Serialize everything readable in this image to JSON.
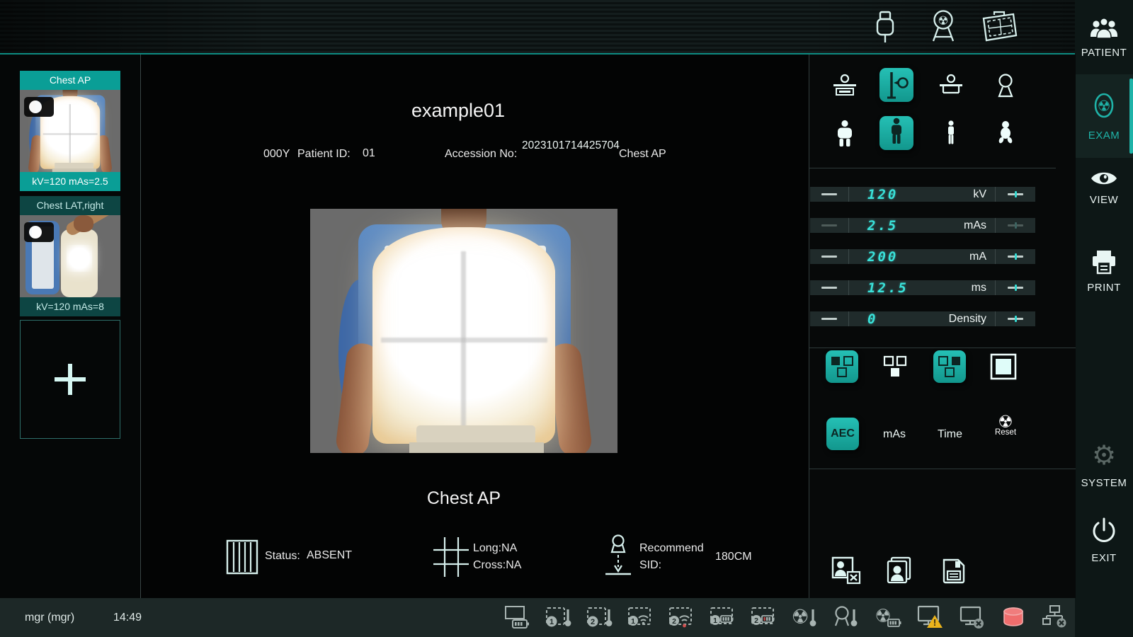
{
  "topbar": {
    "icons": [
      "usb-status",
      "tube-status",
      "detector-status"
    ]
  },
  "sidebar": {
    "items": [
      {
        "label": "PATIENT",
        "icon": "patients-icon",
        "active": false
      },
      {
        "label": "EXAM",
        "icon": "radiation-oval-icon",
        "active": true
      },
      {
        "label": "VIEW",
        "icon": "eye-icon",
        "active": false
      },
      {
        "label": "PRINT",
        "icon": "printer-icon",
        "active": false
      },
      {
        "label": "SYSTEM",
        "icon": "gear-icon",
        "active": false
      },
      {
        "label": "EXIT",
        "icon": "power-icon",
        "active": false
      }
    ]
  },
  "thumbnails": [
    {
      "title": "Chest AP",
      "tech": "kV=120 mAs=2.5",
      "selected": true
    },
    {
      "title": "Chest LAT,right",
      "tech": "kV=120 mAs=8",
      "selected": false
    }
  ],
  "study": {
    "patient_name": "example01",
    "age": "000Y",
    "patient_id_label": "Patient ID:",
    "patient_id": "01",
    "accession_label": "Accession No:",
    "accession_no": "2023101714425704",
    "view_name": "Chest AP"
  },
  "view_info": {
    "title": "Chest AP",
    "status_label": "Status:",
    "status_value": "ABSENT",
    "long_value": "Long:NA",
    "cross_value": "Cross:NA",
    "recommend_label": "Recommend",
    "sid_label": "SID:",
    "sid_value": "180CM"
  },
  "generator": {
    "rows": [
      {
        "value": "120",
        "unit": "kV"
      },
      {
        "value": "2.5",
        "unit": "mAs"
      },
      {
        "value": "200",
        "unit": "mA"
      },
      {
        "value": "12.5",
        "unit": "ms"
      },
      {
        "value": "0",
        "unit": "Density"
      }
    ]
  },
  "positions": {
    "receptors": [
      "table-bucky",
      "wall-stand",
      "table-top",
      "free-exposure"
    ],
    "selected_receptor": "wall-stand",
    "body_types": [
      "large-adult",
      "adult",
      "slim-adult",
      "child"
    ],
    "selected_body_type": "adult"
  },
  "aec": {
    "chambers": [
      "left-chamber",
      "center-chamber",
      "right-chamber",
      "full-field"
    ],
    "modes": {
      "aec": "AEC",
      "mas": "mAs",
      "time": "Time",
      "reset": "Reset"
    },
    "active_mode": "AEC"
  },
  "statusbar": {
    "user": "mgr (mgr)",
    "time": "14:49",
    "icons": [
      "console-battery",
      "detector1-temperature",
      "detector2-temperature",
      "detector1-signal",
      "detector2-signal",
      "detector1-battery",
      "detector2-battery",
      "tube-temperature",
      "collimator-temperature",
      "generator-battery",
      "workstation-warning",
      "workstation-disconnected",
      "storage-full",
      "network-disconnected"
    ]
  },
  "colors": {
    "accent": "#14a89e",
    "digit": "#3ae2da",
    "warning": "#eab31c",
    "alert": "#ef6a6a"
  }
}
